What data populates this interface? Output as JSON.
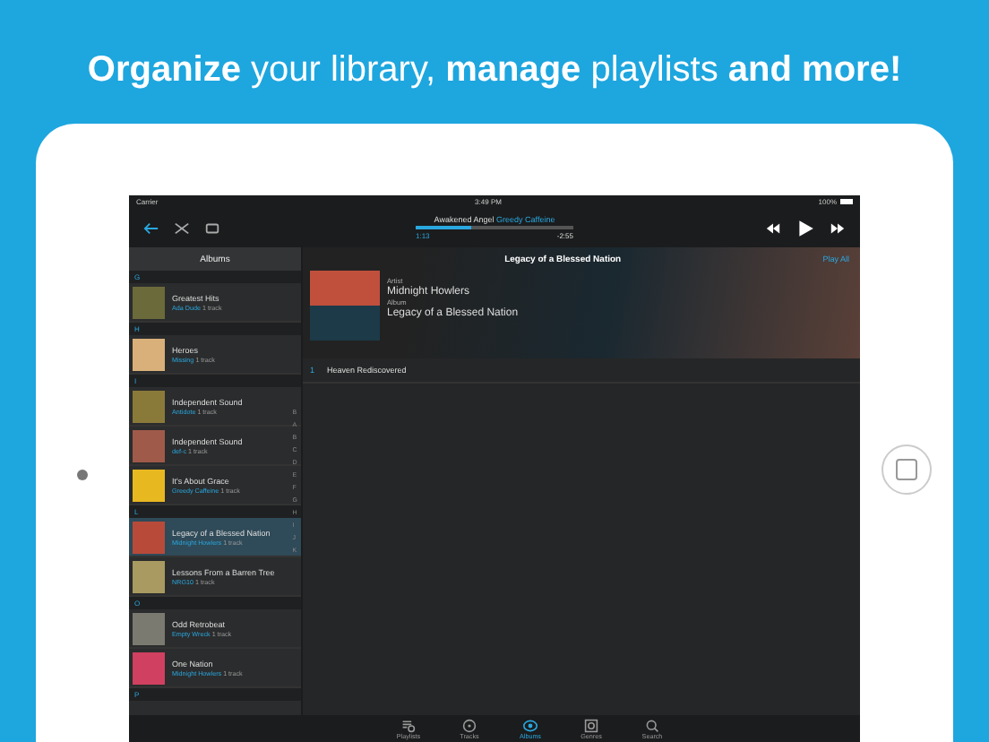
{
  "headline": "**Organize** your library, **manage** playlists **and more!**",
  "status_bar": {
    "carrier": "Carrier",
    "time": "3:49 PM",
    "battery": "100%"
  },
  "now_playing": {
    "title": "Awakened Angel",
    "artist": "Greedy Caffeine",
    "elapsed": "1:13",
    "remaining": "-2:55",
    "level": 0.35
  },
  "sidebar": {
    "title": "Albums",
    "index": [
      "B",
      "A",
      "B",
      "C",
      "D",
      "E",
      "F",
      "G",
      "H",
      "I",
      "J",
      "K"
    ],
    "sections": [
      {
        "letter": "G",
        "albums": [
          {
            "title": "Greatest Hits",
            "artist": "Ada Dude",
            "count": "1 track",
            "selected": false,
            "color": "#6b6a3a"
          }
        ]
      },
      {
        "letter": "H",
        "albums": [
          {
            "title": "Heroes",
            "artist": "Missing",
            "count": "1 track",
            "selected": false,
            "color": "#d9b07a"
          }
        ]
      },
      {
        "letter": "I",
        "albums": [
          {
            "title": "Independent Sound",
            "artist": "Antidote",
            "count": "1 track",
            "selected": false,
            "color": "#8a7a3a"
          },
          {
            "title": "Independent Sound",
            "artist": "def-c",
            "count": "1 track",
            "selected": false,
            "color": "#a05a4a"
          },
          {
            "title": "It's About Grace",
            "artist": "Greedy Caffeine",
            "count": "1 track",
            "selected": false,
            "color": "#e8b820"
          }
        ]
      },
      {
        "letter": "L",
        "albums": [
          {
            "title": "Legacy of a Blessed Nation",
            "artist": "Midnight Howlers",
            "count": "1 track",
            "selected": true,
            "color": "#b84a3a"
          },
          {
            "title": "Lessons From a Barren Tree",
            "artist": "NRG10",
            "count": "1 track",
            "selected": false,
            "color": "#a89a60"
          }
        ]
      },
      {
        "letter": "O",
        "albums": [
          {
            "title": "Odd Retrobeat",
            "artist": "Empty Wreck",
            "count": "1 track",
            "selected": false,
            "color": "#7a7a70"
          },
          {
            "title": "One Nation",
            "artist": "Midnight Howlers",
            "count": "1 track",
            "selected": false,
            "color": "#d04060"
          }
        ]
      },
      {
        "letter": "P"
      }
    ]
  },
  "detail": {
    "title": "Legacy of a Blessed Nation",
    "play_all": "Play All",
    "artist_label": "Artist",
    "artist": "Midnight Howlers",
    "album_label": "Album",
    "album": "Legacy of a Blessed Nation",
    "tracks": [
      {
        "number": "1",
        "title": "Heaven Rediscovered"
      }
    ]
  },
  "tabs": [
    {
      "label": "Playlists",
      "kind": "playlists",
      "selected": false
    },
    {
      "label": "Tracks",
      "kind": "tracks",
      "selected": false
    },
    {
      "label": "Albums",
      "kind": "albums",
      "selected": true
    },
    {
      "label": "Genres",
      "kind": "genres",
      "selected": false
    },
    {
      "label": "Search",
      "kind": "search",
      "selected": false
    }
  ]
}
